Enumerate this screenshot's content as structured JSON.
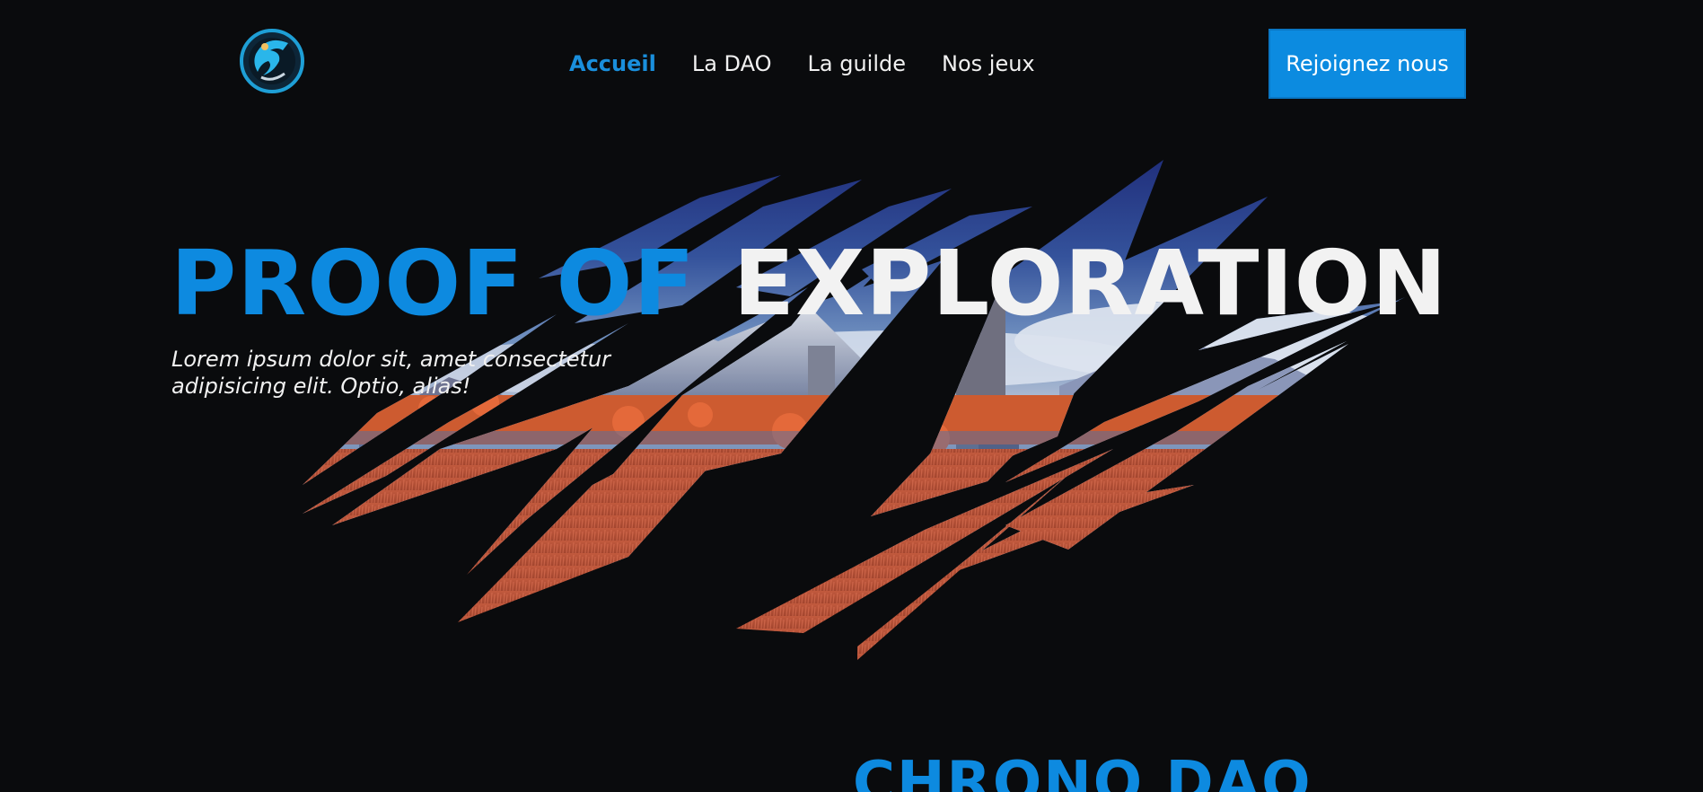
{
  "header": {
    "logo_alt": "dragon-logo",
    "nav": [
      {
        "label": "Accueil",
        "active": true
      },
      {
        "label": "La DAO",
        "active": false
      },
      {
        "label": "La guilde",
        "active": false
      },
      {
        "label": "Nos jeux",
        "active": false
      }
    ],
    "cta_label": "Rejoignez nous"
  },
  "hero": {
    "title_blue": "PROOF OF",
    "title_white": "EXPLORATION",
    "subtitle_line1": "Lorem ipsum dolor sit, amet consectetur",
    "subtitle_line2": "adipisicing elit. Optio, alias!"
  },
  "next_section": {
    "title": "CHRONO DAO"
  },
  "colors": {
    "background": "#0a0b0d",
    "accent": "#0c8be0",
    "text": "#f1f1f1"
  }
}
